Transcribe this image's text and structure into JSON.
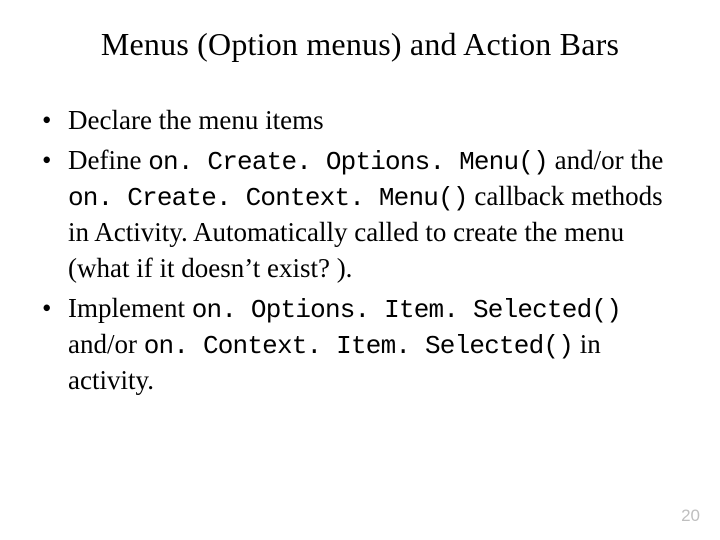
{
  "title": "Menus (Option menus) and Action Bars",
  "bullets": {
    "b1": "Declare the menu items",
    "b2": {
      "t1": "Define ",
      "c1": "on. Create. Options. Menu()",
      "t2": " and/or the ",
      "c2": "on. Create. Context. Menu()",
      "t3": " callback methods in Activity. Automatically called to create the menu (what if it doesn’t exist? )."
    },
    "b3": {
      "t1": "Implement ",
      "c1": "on. Options. Item. Selected()",
      "t2": " and/or ",
      "c2": "on. Context. Item. Selected()",
      "t3": " in activity."
    }
  },
  "page_number": "20"
}
